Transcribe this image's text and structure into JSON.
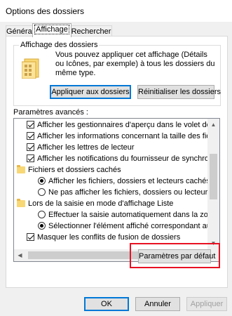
{
  "window": {
    "title": "Options des dossiers"
  },
  "tabs": [
    {
      "label": "Général"
    },
    {
      "label": "Affichage"
    },
    {
      "label": "Rechercher"
    }
  ],
  "folder_views": {
    "legend": "Affichage des dossiers",
    "icon": "folder-grid-icon",
    "description": "Vous pouvez appliquer cet affichage (Détails ou Icônes, par exemple) à tous les dossiers du même type.",
    "apply_label": "Appliquer aux dossiers",
    "reset_label": "Réinitialiser les dossiers"
  },
  "advanced": {
    "label": "Paramètres avancés :",
    "items": [
      {
        "kind": "checkbox",
        "checked": true,
        "text": "Afficher les gestionnaires d'aperçu dans le volet de visual"
      },
      {
        "kind": "checkbox",
        "checked": true,
        "text": "Afficher les informations concernant la taille des fichiers d"
      },
      {
        "kind": "checkbox",
        "checked": true,
        "text": "Afficher les lettres de lecteur"
      },
      {
        "kind": "checkbox",
        "checked": true,
        "text": "Afficher les notifications du fournisseur de synchronisation"
      },
      {
        "kind": "folder",
        "text": "Fichiers et dossiers cachés"
      },
      {
        "kind": "radio",
        "checked": true,
        "text": "Afficher les fichiers, dossiers et lecteurs cachés"
      },
      {
        "kind": "radio",
        "checked": false,
        "text": "Ne pas afficher les fichiers, dossiers ou lecteurs cach"
      },
      {
        "kind": "folder",
        "text": "Lors de la saisie en mode d'affichage Liste"
      },
      {
        "kind": "radio",
        "checked": false,
        "text": "Effectuer la saisie automatiquement dans la zone Rec"
      },
      {
        "kind": "radio",
        "checked": true,
        "text": "Sélectionner l'élément affiché correspondant au texte"
      },
      {
        "kind": "checkbox",
        "checked": true,
        "text": "Masquer les conflits de fusion de dossiers"
      }
    ]
  },
  "restore_defaults_label": "Paramètres par défaut",
  "footer": {
    "ok": "OK",
    "cancel": "Annuler",
    "apply": "Appliquer"
  },
  "colors": {
    "highlight": "#e81123",
    "focus_blue": "#0078d7"
  }
}
